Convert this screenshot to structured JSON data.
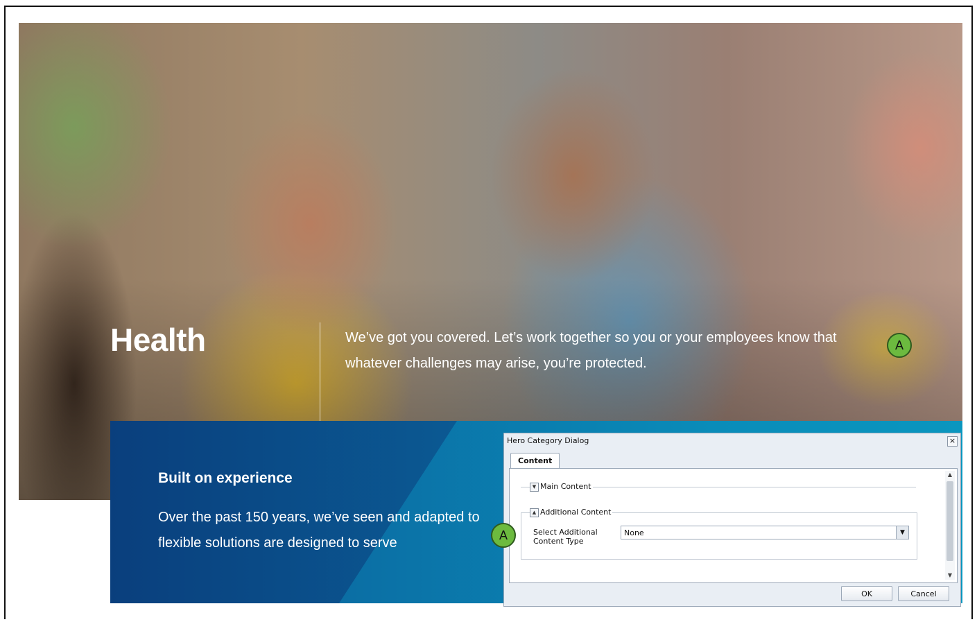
{
  "hero": {
    "title": "Health",
    "description": "We’ve got you covered. Let’s work together so you or your employees know that whatever challenges may arise, you’re protected."
  },
  "panel": {
    "title": "Built on experience",
    "text": "Over the past 150 years, we’ve seen and adapted to flexible solutions are designed to serve"
  },
  "markers": {
    "top": "A",
    "bottom": "A"
  },
  "dialog": {
    "title": "Hero Category Dialog",
    "close_glyph": "×",
    "tab": "Content",
    "main_section": "Main Content",
    "additional_section": "Additional Content",
    "select_label": "Select Additional Content Type",
    "select_value": "None",
    "ok": "OK",
    "cancel": "Cancel"
  },
  "colors": {
    "marker": "#6cba3f",
    "panel_blue": "#0b5c95",
    "dialog_bg": "#e9eef4"
  },
  "icons": [
    "close-icon",
    "collapse-icon",
    "expand-icon",
    "dropdown-arrow-icon",
    "scroll-up-icon",
    "scroll-down-icon"
  ]
}
